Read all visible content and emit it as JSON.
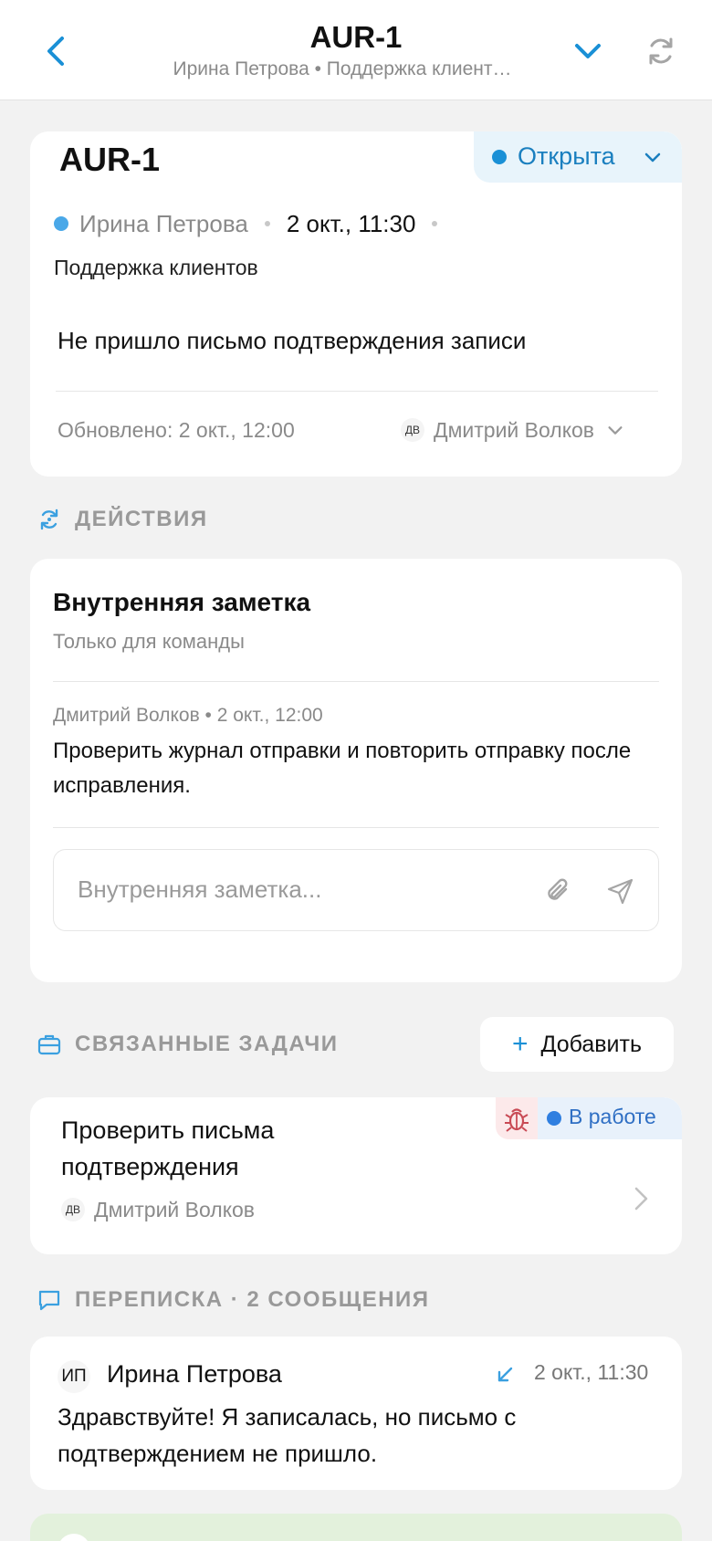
{
  "header": {
    "title": "AUR-1",
    "subtitle": "Ирина Петрова • Поддержка клиент…"
  },
  "ticket": {
    "id": "AUR-1",
    "status": "Открыта",
    "author": "Ирина Петрова",
    "date": "2 окт., 11:30",
    "department": "Поддержка клиентов",
    "subject": "Не пришло письмо подтверждения записи",
    "updated": "Обновлено: 2 окт., 12:00",
    "assignee_initials": "ДВ",
    "assignee": "Дмитрий Волков"
  },
  "actions": {
    "section_label": "ДЕЙСТВИЯ",
    "note_title": "Внутренняя заметка",
    "note_subtitle": "Только для команды",
    "note_meta": "Дмитрий Волков • 2 окт., 12:00",
    "note_text": "Проверить журнал отправки и повторить отправку после исправления.",
    "note_placeholder": "Внутренняя заметка..."
  },
  "related": {
    "section_label": "СВЯЗАННЫЕ ЗАДАЧИ",
    "add_label": "Добавить",
    "tasks": [
      {
        "title": "Проверить письма подтверждения",
        "status": "В работе",
        "assignee_initials": "ДВ",
        "assignee": "Дмитрий Волков"
      }
    ]
  },
  "correspondence": {
    "section_label": "ПЕРЕПИСКА · 2 СООБЩЕНИЯ",
    "messages": [
      {
        "initials": "ИП",
        "author": "Ирина Петрова",
        "date": "2 окт., 11:30",
        "text": "Здравствуйте! Я записалась, но письмо с подтверждением не пришло."
      }
    ]
  },
  "colors": {
    "accent": "#1a90d6",
    "status_open_bg": "#e8f4fb",
    "in_progress": "#2f7fe0",
    "bug": "#c94a55",
    "outgoing_bg": "#e3f1dc"
  }
}
